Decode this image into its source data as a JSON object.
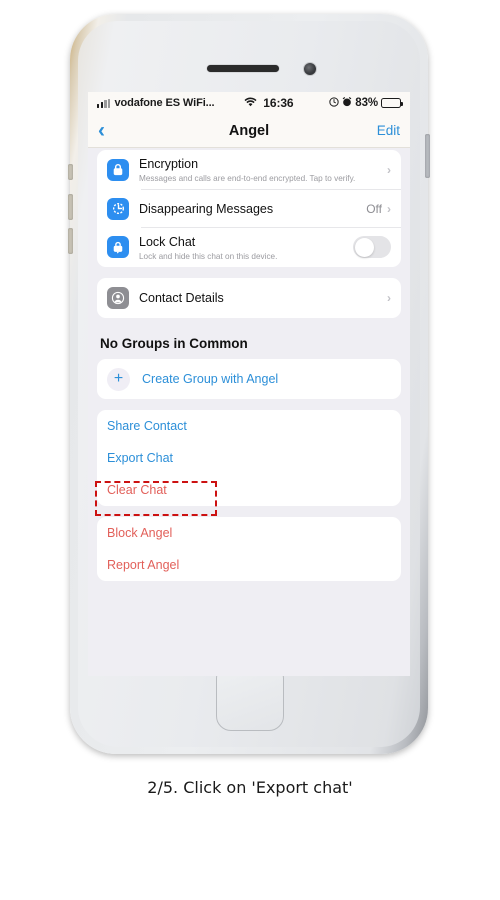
{
  "caption": "2/5. Click on 'Export chat'",
  "status_bar": {
    "carrier": "vodafone ES WiFi...",
    "time": "16:36",
    "battery_percent": "83%",
    "wifi_icon": "wifi-icon",
    "signal_icon": "signal-bars-icon",
    "alarm_icon": "alarm-icon",
    "location_icon": "location-icon",
    "battery_icon": "battery-icon"
  },
  "nav": {
    "back_icon": "chevron-left-icon",
    "title": "Angel",
    "edit_label": "Edit"
  },
  "settings_card": {
    "rows": [
      {
        "icon": "lock-icon",
        "icon_color": "#2d8ef0",
        "title": "Encryption",
        "subtitle": "Messages and calls are end-to-end encrypted. Tap to verify.",
        "accessory": "chevron"
      },
      {
        "icon": "timer-icon",
        "icon_color": "#2d8ef0",
        "title": "Disappearing Messages",
        "value": "Off",
        "accessory": "chevron"
      },
      {
        "icon": "lock-chat-icon",
        "icon_color": "#2d8ef0",
        "title": "Lock Chat",
        "subtitle": "Lock and hide this chat on this device.",
        "accessory": "toggle",
        "toggle_on": false
      }
    ]
  },
  "contact_card": {
    "icon": "contact-person-icon",
    "icon_color": "#8e8e93",
    "title": "Contact Details",
    "accessory": "chevron"
  },
  "groups_section": {
    "header": "No Groups in Common",
    "create_group": {
      "icon": "plus-icon",
      "label": "Create Group with Angel"
    }
  },
  "actions_card": {
    "items": [
      {
        "label": "Share Contact",
        "style": "blue"
      },
      {
        "label": "Export Chat",
        "style": "blue",
        "highlighted": true
      },
      {
        "label": "Clear Chat",
        "style": "red"
      }
    ]
  },
  "danger_card": {
    "items": [
      {
        "label": "Block Angel",
        "style": "red"
      },
      {
        "label": "Report Angel",
        "style": "red"
      }
    ]
  },
  "colors": {
    "accent_blue": "#2c8fd8",
    "danger_red": "#e2605a",
    "annotation_red": "#cc1111",
    "screen_bg": "#efeef3",
    "card_bg": "#ffffff"
  }
}
